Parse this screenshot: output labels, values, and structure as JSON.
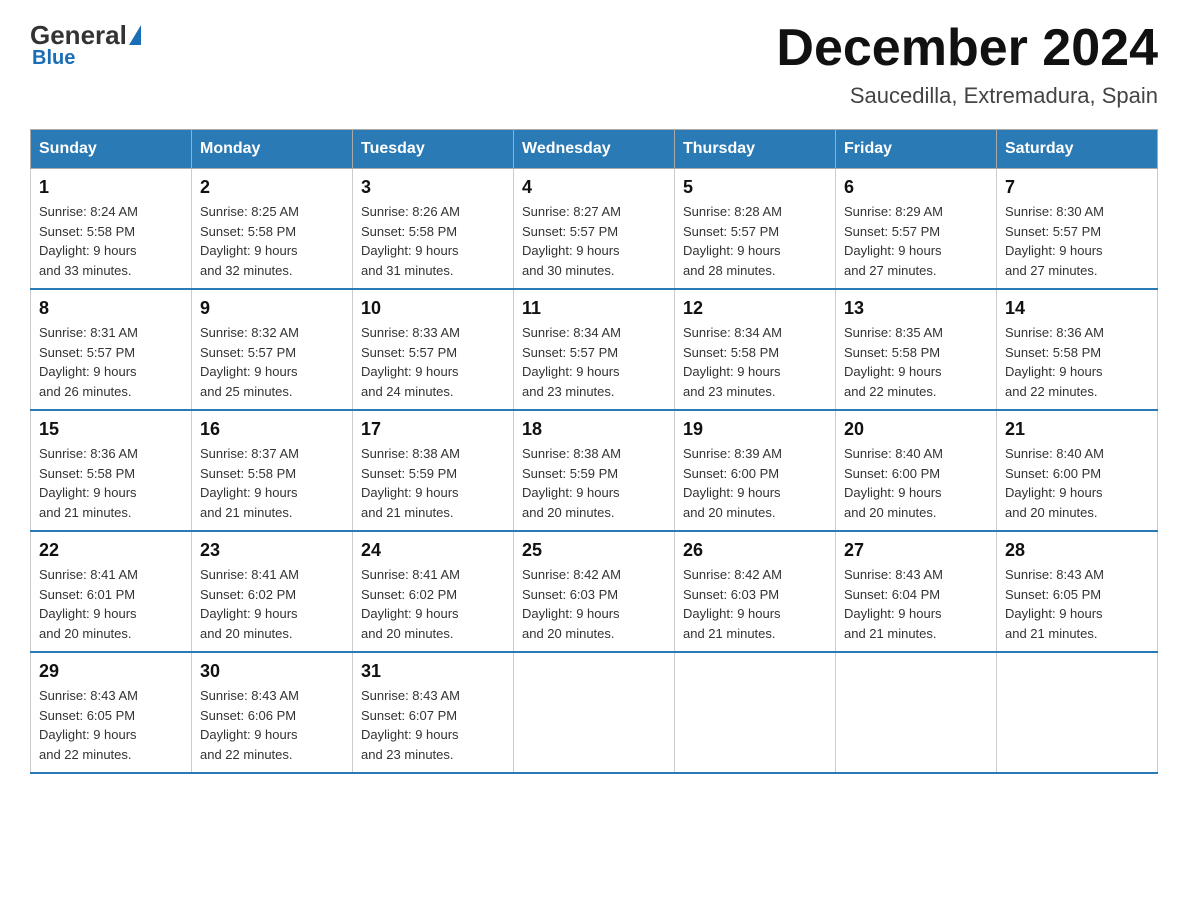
{
  "logo": {
    "general": "General",
    "blue": "Blue"
  },
  "title": "December 2024",
  "subtitle": "Saucedilla, Extremadura, Spain",
  "days_of_week": [
    "Sunday",
    "Monday",
    "Tuesday",
    "Wednesday",
    "Thursday",
    "Friday",
    "Saturday"
  ],
  "weeks": [
    [
      {
        "day": "1",
        "sunrise": "8:24 AM",
        "sunset": "5:58 PM",
        "daylight": "9 hours and 33 minutes."
      },
      {
        "day": "2",
        "sunrise": "8:25 AM",
        "sunset": "5:58 PM",
        "daylight": "9 hours and 32 minutes."
      },
      {
        "day": "3",
        "sunrise": "8:26 AM",
        "sunset": "5:58 PM",
        "daylight": "9 hours and 31 minutes."
      },
      {
        "day": "4",
        "sunrise": "8:27 AM",
        "sunset": "5:57 PM",
        "daylight": "9 hours and 30 minutes."
      },
      {
        "day": "5",
        "sunrise": "8:28 AM",
        "sunset": "5:57 PM",
        "daylight": "9 hours and 28 minutes."
      },
      {
        "day": "6",
        "sunrise": "8:29 AM",
        "sunset": "5:57 PM",
        "daylight": "9 hours and 27 minutes."
      },
      {
        "day": "7",
        "sunrise": "8:30 AM",
        "sunset": "5:57 PM",
        "daylight": "9 hours and 27 minutes."
      }
    ],
    [
      {
        "day": "8",
        "sunrise": "8:31 AM",
        "sunset": "5:57 PM",
        "daylight": "9 hours and 26 minutes."
      },
      {
        "day": "9",
        "sunrise": "8:32 AM",
        "sunset": "5:57 PM",
        "daylight": "9 hours and 25 minutes."
      },
      {
        "day": "10",
        "sunrise": "8:33 AM",
        "sunset": "5:57 PM",
        "daylight": "9 hours and 24 minutes."
      },
      {
        "day": "11",
        "sunrise": "8:34 AM",
        "sunset": "5:57 PM",
        "daylight": "9 hours and 23 minutes."
      },
      {
        "day": "12",
        "sunrise": "8:34 AM",
        "sunset": "5:58 PM",
        "daylight": "9 hours and 23 minutes."
      },
      {
        "day": "13",
        "sunrise": "8:35 AM",
        "sunset": "5:58 PM",
        "daylight": "9 hours and 22 minutes."
      },
      {
        "day": "14",
        "sunrise": "8:36 AM",
        "sunset": "5:58 PM",
        "daylight": "9 hours and 22 minutes."
      }
    ],
    [
      {
        "day": "15",
        "sunrise": "8:36 AM",
        "sunset": "5:58 PM",
        "daylight": "9 hours and 21 minutes."
      },
      {
        "day": "16",
        "sunrise": "8:37 AM",
        "sunset": "5:58 PM",
        "daylight": "9 hours and 21 minutes."
      },
      {
        "day": "17",
        "sunrise": "8:38 AM",
        "sunset": "5:59 PM",
        "daylight": "9 hours and 21 minutes."
      },
      {
        "day": "18",
        "sunrise": "8:38 AM",
        "sunset": "5:59 PM",
        "daylight": "9 hours and 20 minutes."
      },
      {
        "day": "19",
        "sunrise": "8:39 AM",
        "sunset": "6:00 PM",
        "daylight": "9 hours and 20 minutes."
      },
      {
        "day": "20",
        "sunrise": "8:40 AM",
        "sunset": "6:00 PM",
        "daylight": "9 hours and 20 minutes."
      },
      {
        "day": "21",
        "sunrise": "8:40 AM",
        "sunset": "6:00 PM",
        "daylight": "9 hours and 20 minutes."
      }
    ],
    [
      {
        "day": "22",
        "sunrise": "8:41 AM",
        "sunset": "6:01 PM",
        "daylight": "9 hours and 20 minutes."
      },
      {
        "day": "23",
        "sunrise": "8:41 AM",
        "sunset": "6:02 PM",
        "daylight": "9 hours and 20 minutes."
      },
      {
        "day": "24",
        "sunrise": "8:41 AM",
        "sunset": "6:02 PM",
        "daylight": "9 hours and 20 minutes."
      },
      {
        "day": "25",
        "sunrise": "8:42 AM",
        "sunset": "6:03 PM",
        "daylight": "9 hours and 20 minutes."
      },
      {
        "day": "26",
        "sunrise": "8:42 AM",
        "sunset": "6:03 PM",
        "daylight": "9 hours and 21 minutes."
      },
      {
        "day": "27",
        "sunrise": "8:43 AM",
        "sunset": "6:04 PM",
        "daylight": "9 hours and 21 minutes."
      },
      {
        "day": "28",
        "sunrise": "8:43 AM",
        "sunset": "6:05 PM",
        "daylight": "9 hours and 21 minutes."
      }
    ],
    [
      {
        "day": "29",
        "sunrise": "8:43 AM",
        "sunset": "6:05 PM",
        "daylight": "9 hours and 22 minutes."
      },
      {
        "day": "30",
        "sunrise": "8:43 AM",
        "sunset": "6:06 PM",
        "daylight": "9 hours and 22 minutes."
      },
      {
        "day": "31",
        "sunrise": "8:43 AM",
        "sunset": "6:07 PM",
        "daylight": "9 hours and 23 minutes."
      },
      null,
      null,
      null,
      null
    ]
  ],
  "labels": {
    "sunrise": "Sunrise:",
    "sunset": "Sunset:",
    "daylight": "Daylight:"
  }
}
